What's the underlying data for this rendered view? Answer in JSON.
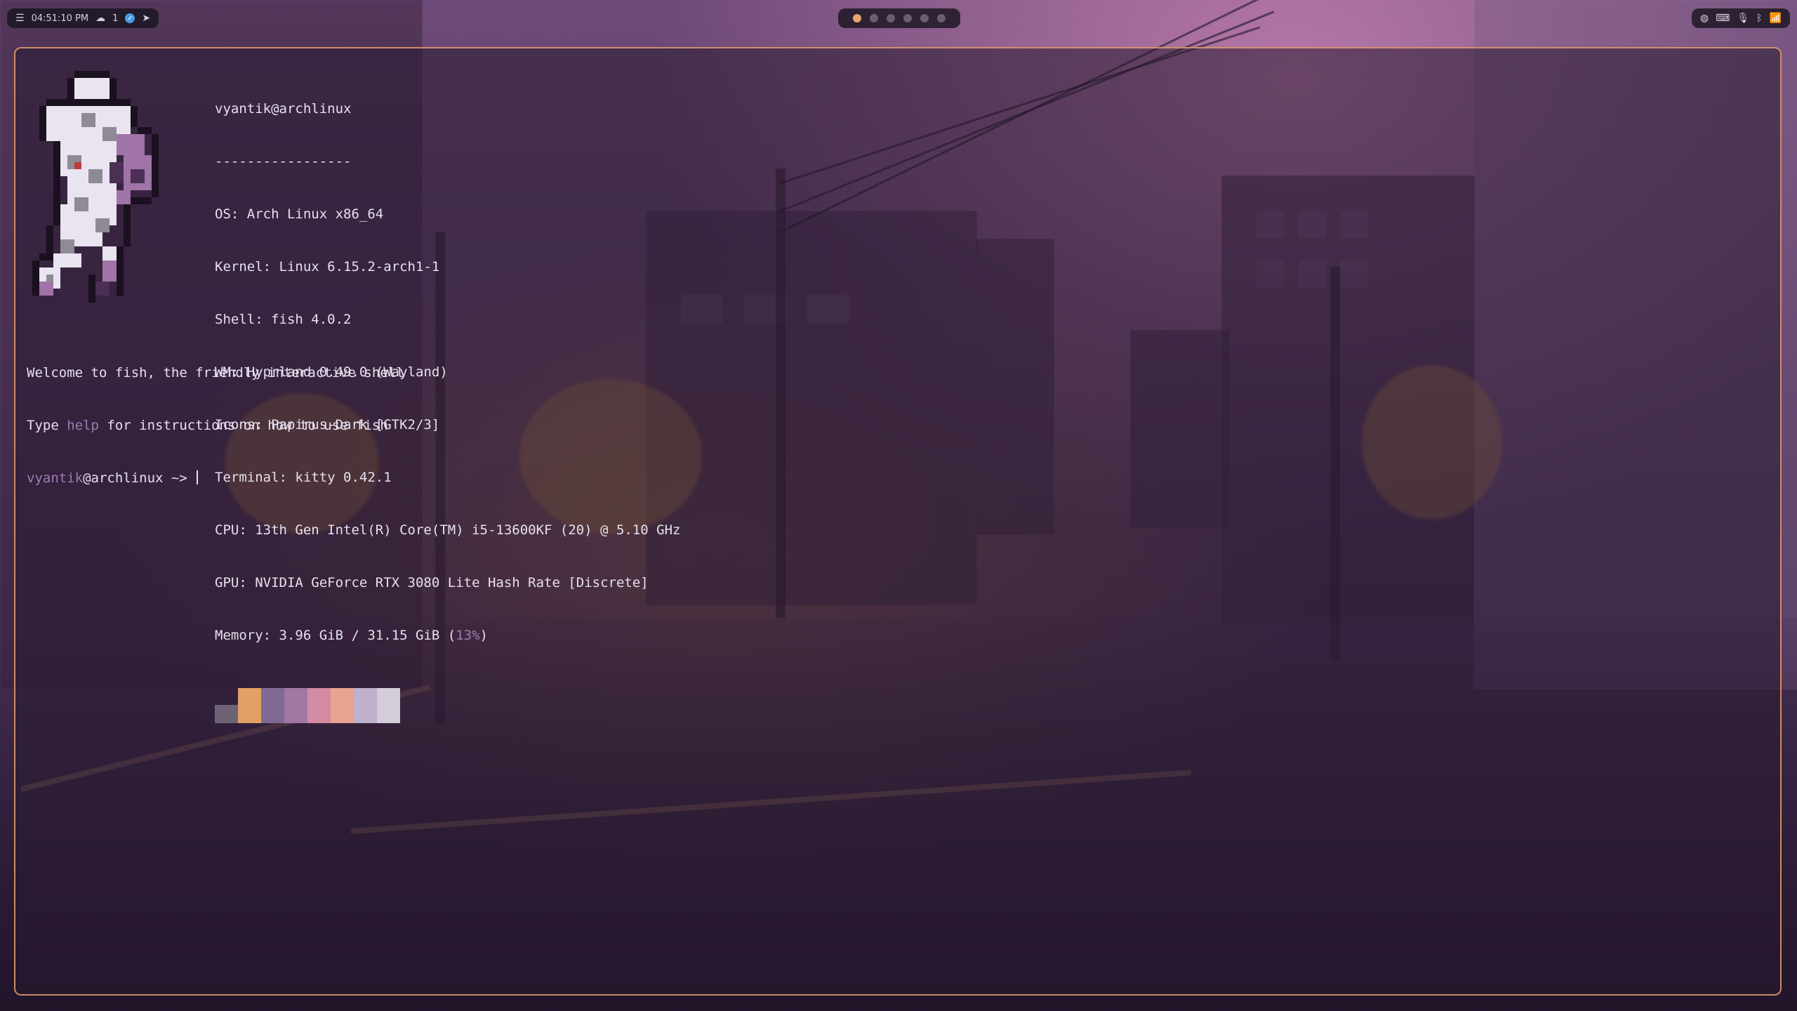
{
  "topbar": {
    "time": "04:51:10 PM",
    "cloud_count": "1",
    "workspaces": [
      {
        "active": true
      },
      {
        "active": false
      },
      {
        "active": false
      },
      {
        "active": false
      },
      {
        "active": false
      },
      {
        "active": false
      }
    ],
    "tray_icons": [
      "globe-icon",
      "keyboard-icon",
      "microphone-icon",
      "bluetooth-icon",
      "wifi-icon"
    ]
  },
  "terminal": {
    "user_host": "vyantik@archlinux",
    "separator": "-----------------",
    "info": [
      {
        "key": "OS",
        "value": "Arch Linux x86_64"
      },
      {
        "key": "Kernel",
        "value": "Linux 6.15.2-arch1-1"
      },
      {
        "key": "Shell",
        "value": "fish 4.0.2"
      },
      {
        "key": "WM",
        "value": "Hyprland 0.49.0 (Wayland)"
      },
      {
        "key": "Icons",
        "value": "Papirus-Dark [GTK2/3]"
      },
      {
        "key": "Terminal",
        "value": "kitty 0.42.1"
      },
      {
        "key": "CPU",
        "value": "13th Gen Intel(R) Core(TM) i5-13600KF (20) @ 5.10 GHz"
      },
      {
        "key": "GPU",
        "value": "NVIDIA GeForce RTX 3080 Lite Hash Rate [Discrete]"
      }
    ],
    "memory": {
      "label": "Memory",
      "used": "3.96 GiB",
      "total": "31.15 GiB",
      "percent": "13%"
    },
    "palette": [
      "#6d6374",
      "#e3a066",
      "#7e6a95",
      "#9f79a4",
      "#d38aa3",
      "#e8a290",
      "#bfb0cc",
      "#d4cdd9"
    ],
    "welcome_line": "Welcome to fish, the friendly interactive shell",
    "help_prefix": "Type ",
    "help_word": "help",
    "help_suffix": " for instructions on how to use fish",
    "prompt_user": "vyantik",
    "prompt_host": "@archlinux",
    "prompt_arrow": " ~> "
  },
  "colors": {
    "border": "#e8a06e",
    "highlight": "#9d7db0",
    "text": "#e6e0ef"
  }
}
